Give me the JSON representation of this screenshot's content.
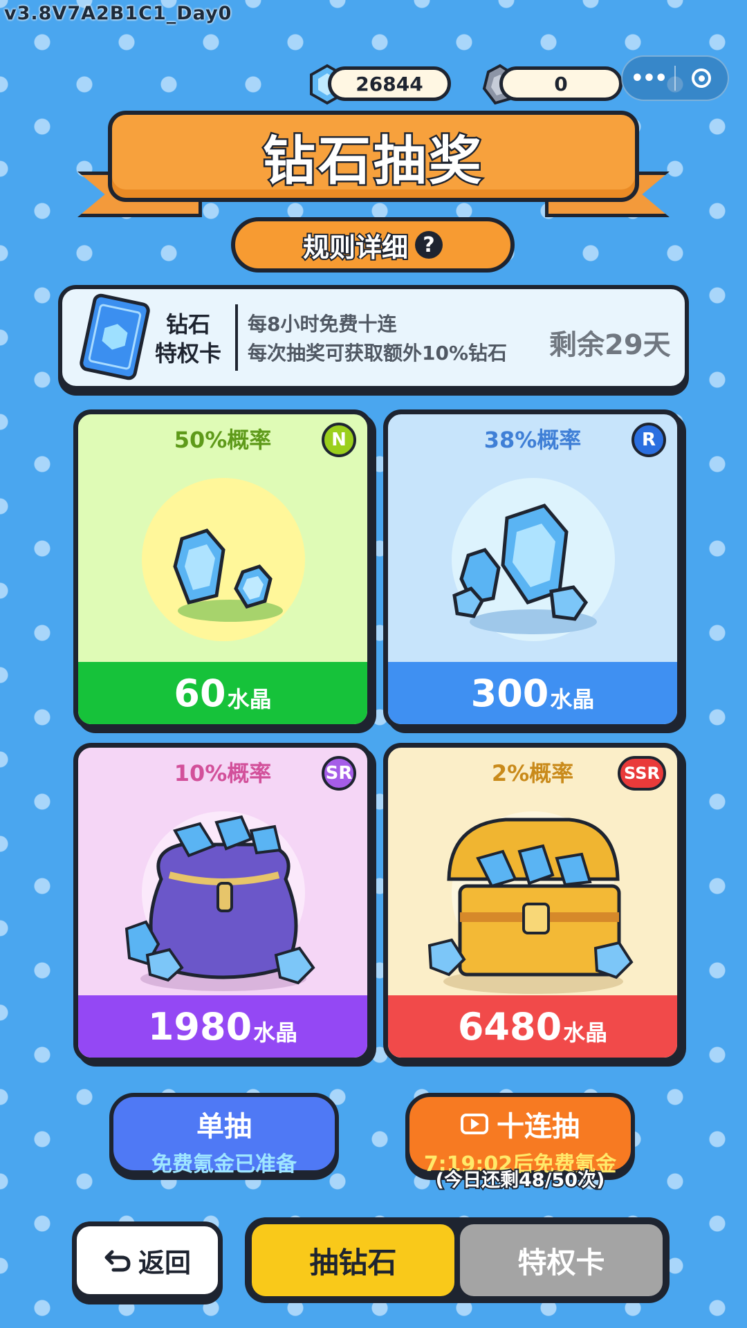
{
  "version": "v3.8V7A2B1C1_Day0",
  "currency": {
    "diamond": "26844",
    "shard": "0"
  },
  "capsule": {
    "more": "•••"
  },
  "title": "钻石抽奖",
  "rules_label": "规则详细",
  "rules_icon": "?",
  "privilege": {
    "name_line1": "钻石",
    "name_line2": "特权卡",
    "desc_line1": "每8小时免费十连",
    "desc_line2": "每次抽奖可获取额外10%钻石",
    "remaining": "剩余29天"
  },
  "prizes": [
    {
      "probability": "50%概率",
      "rarity": "N",
      "amount": "60",
      "unit": "水晶",
      "theme": "#16c23a"
    },
    {
      "probability": "38%概率",
      "rarity": "R",
      "amount": "300",
      "unit": "水晶",
      "theme": "#3f90f2"
    },
    {
      "probability": "10%概率",
      "rarity": "SR",
      "amount": "1980",
      "unit": "水晶",
      "theme": "#9448f4"
    },
    {
      "probability": "2%概率",
      "rarity": "SSR",
      "amount": "6480",
      "unit": "水晶",
      "theme": "#f14a4a"
    }
  ],
  "draw": {
    "single_label": "单抽",
    "single_sub": "免费氪金已准备",
    "ten_label": "十连抽",
    "ten_sub": "7:19:02后免费氪金",
    "ten_remaining": "(今日还剩48/50次)"
  },
  "nav": {
    "back_label": "返回",
    "tab_diamond": "抽钻石",
    "tab_card": "特权卡"
  }
}
